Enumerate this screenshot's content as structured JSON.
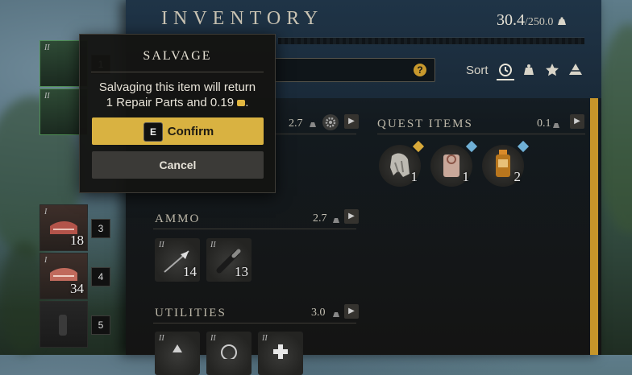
{
  "header": {
    "title": "INVENTORY",
    "weight_current": "30.4",
    "weight_max": "/250.0",
    "sort_label": "Sort",
    "help_glyph": "?"
  },
  "sort_icons": [
    "clock-icon",
    "weight-icon",
    "star-icon",
    "tier-icon"
  ],
  "sections": {
    "top": {
      "weight": "2.7"
    },
    "quest": {
      "title": "QUEST ITEMS",
      "weight": "0.1",
      "items": [
        {
          "name": "claw-trophy",
          "count": "1",
          "marker": "gold"
        },
        {
          "name": "scroll-note",
          "count": "1",
          "marker": "blue"
        },
        {
          "name": "potion-jar",
          "count": "2",
          "marker": "blue"
        }
      ]
    },
    "ammo": {
      "title": "AMMO",
      "weight": "2.7",
      "items": [
        {
          "tier": "II",
          "count": "14",
          "name": "arrow"
        },
        {
          "tier": "II",
          "count": "13",
          "name": "cartridge"
        }
      ]
    },
    "utilities": {
      "title": "UTILITIES",
      "weight": "3.0",
      "items": [
        {
          "tier": "II"
        },
        {
          "tier": "II"
        },
        {
          "tier": "II"
        }
      ]
    }
  },
  "quickbar": [
    {
      "num": "1",
      "tier": "II"
    },
    {
      "num": "",
      "tier": "II"
    },
    {
      "num": "3",
      "tier": "I",
      "count": "18"
    },
    {
      "num": "4",
      "tier": "I",
      "count": "34"
    },
    {
      "num": "5",
      "tier": ""
    }
  ],
  "salvage": {
    "title": "SALVAGE",
    "message_line1": "Salvaging this item will return",
    "message_line2": "1 Repair Parts and 0.19",
    "message_suffix": ".",
    "confirm_key": "E",
    "confirm_label": "Confirm",
    "cancel_label": "Cancel"
  },
  "colors": {
    "accent_gold": "#d9b241",
    "scrollbar": "#c6952a",
    "panel_bg": "#1a2a39"
  }
}
